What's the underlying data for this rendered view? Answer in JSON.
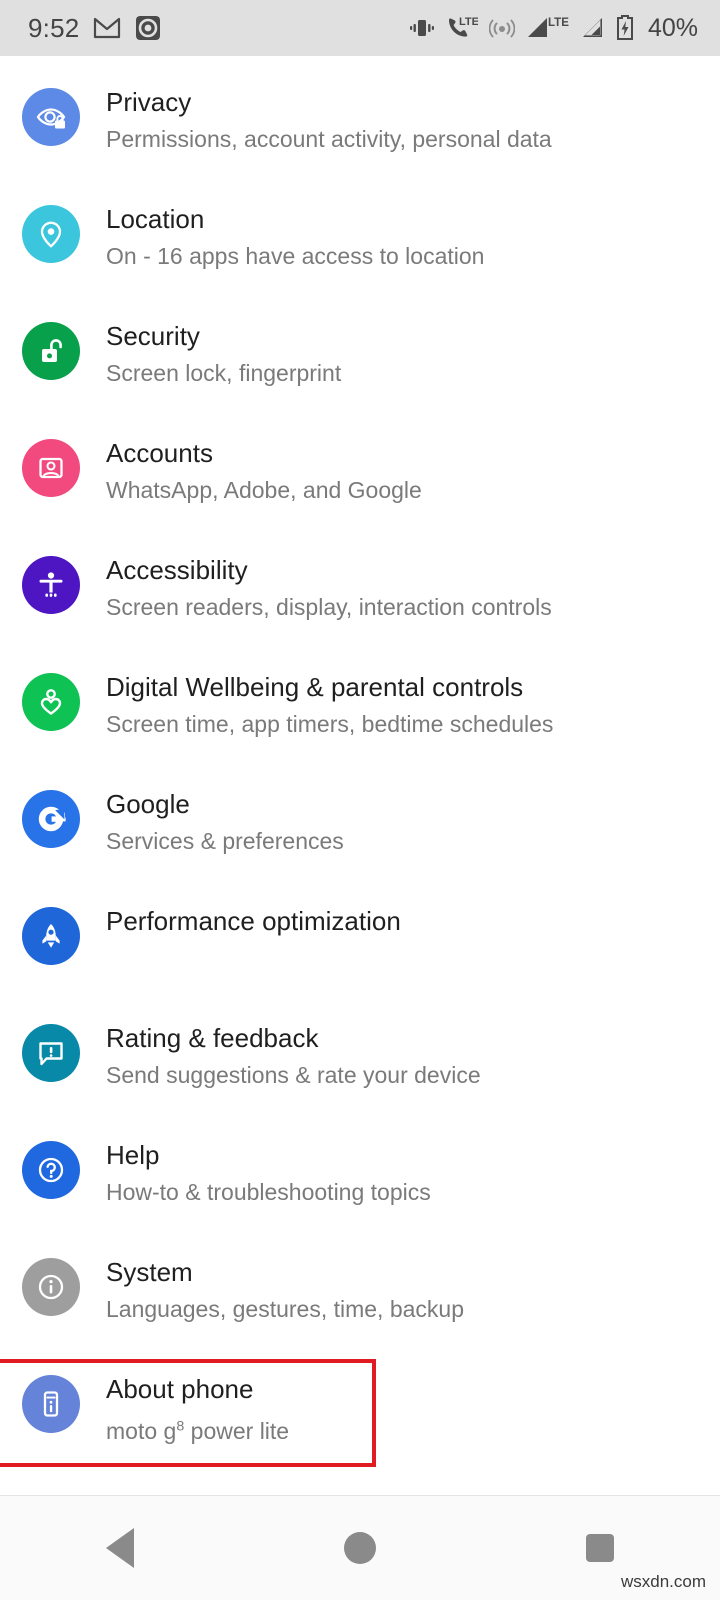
{
  "status_bar": {
    "clock": "9:52",
    "battery_percent": "40%",
    "left_icons": [
      "gmail-icon",
      "screen-recorder-icon"
    ],
    "right_icons": [
      "vibrate-icon",
      "volte-call-icon",
      "hotspot-icon",
      "signal-lte-icon",
      "signal-bars-icon",
      "battery-saver-icon"
    ],
    "background_color": "#e0e0e0"
  },
  "settings": {
    "items": [
      {
        "title": "Privacy",
        "subtitle": "Permissions, account activity, personal data",
        "icon": "eye-lock-icon",
        "icon_color": "#5c8ae6"
      },
      {
        "title": "Location",
        "subtitle": "On - 16 apps have access to location",
        "icon": "location-pin-icon",
        "icon_color": "#3bc6dd"
      },
      {
        "title": "Security",
        "subtitle": "Screen lock, fingerprint",
        "icon": "unlocked-padlock-icon",
        "icon_color": "#08a04b"
      },
      {
        "title": "Accounts",
        "subtitle": "WhatsApp, Adobe, and Google",
        "icon": "account-portrait-icon",
        "icon_color": "#f2497e"
      },
      {
        "title": "Accessibility",
        "subtitle": "Screen readers, display, interaction controls",
        "icon": "accessibility-person-icon",
        "icon_color": "#4e15c2"
      },
      {
        "title": "Digital Wellbeing & parental controls",
        "subtitle": "Screen time, app timers, bedtime schedules",
        "icon": "heart-person-icon",
        "icon_color": "#0ec254"
      },
      {
        "title": "Google",
        "subtitle": "Services & preferences",
        "icon": "google-g-icon",
        "icon_color": "#2873e8"
      },
      {
        "title": "Performance optimization",
        "subtitle": "",
        "icon": "rocket-icon",
        "icon_color": "#1f66d9"
      },
      {
        "title": "Rating & feedback",
        "subtitle": "Send suggestions & rate your device",
        "icon": "feedback-bubble-icon",
        "icon_color": "#0889a8"
      },
      {
        "title": "Help",
        "subtitle": "How-to & troubleshooting topics",
        "icon": "help-question-icon",
        "icon_color": "#2068e0"
      },
      {
        "title": "System",
        "subtitle": "Languages, gestures, time, backup",
        "icon": "info-circle-icon",
        "icon_color": "#9e9e9e"
      },
      {
        "title": "About phone",
        "subtitle": "moto g8 power lite",
        "subtitle_html": "moto g<sup>8</sup> power lite",
        "icon": "phone-info-icon",
        "icon_color": "#6583d8",
        "highlighted": true
      }
    ]
  },
  "highlight": {
    "color": "#e01b22",
    "target": "About phone"
  },
  "nav_bar": {
    "buttons": [
      "back-button",
      "home-button",
      "recents-button"
    ]
  },
  "watermark": {
    "text": "wsxdn.com"
  }
}
